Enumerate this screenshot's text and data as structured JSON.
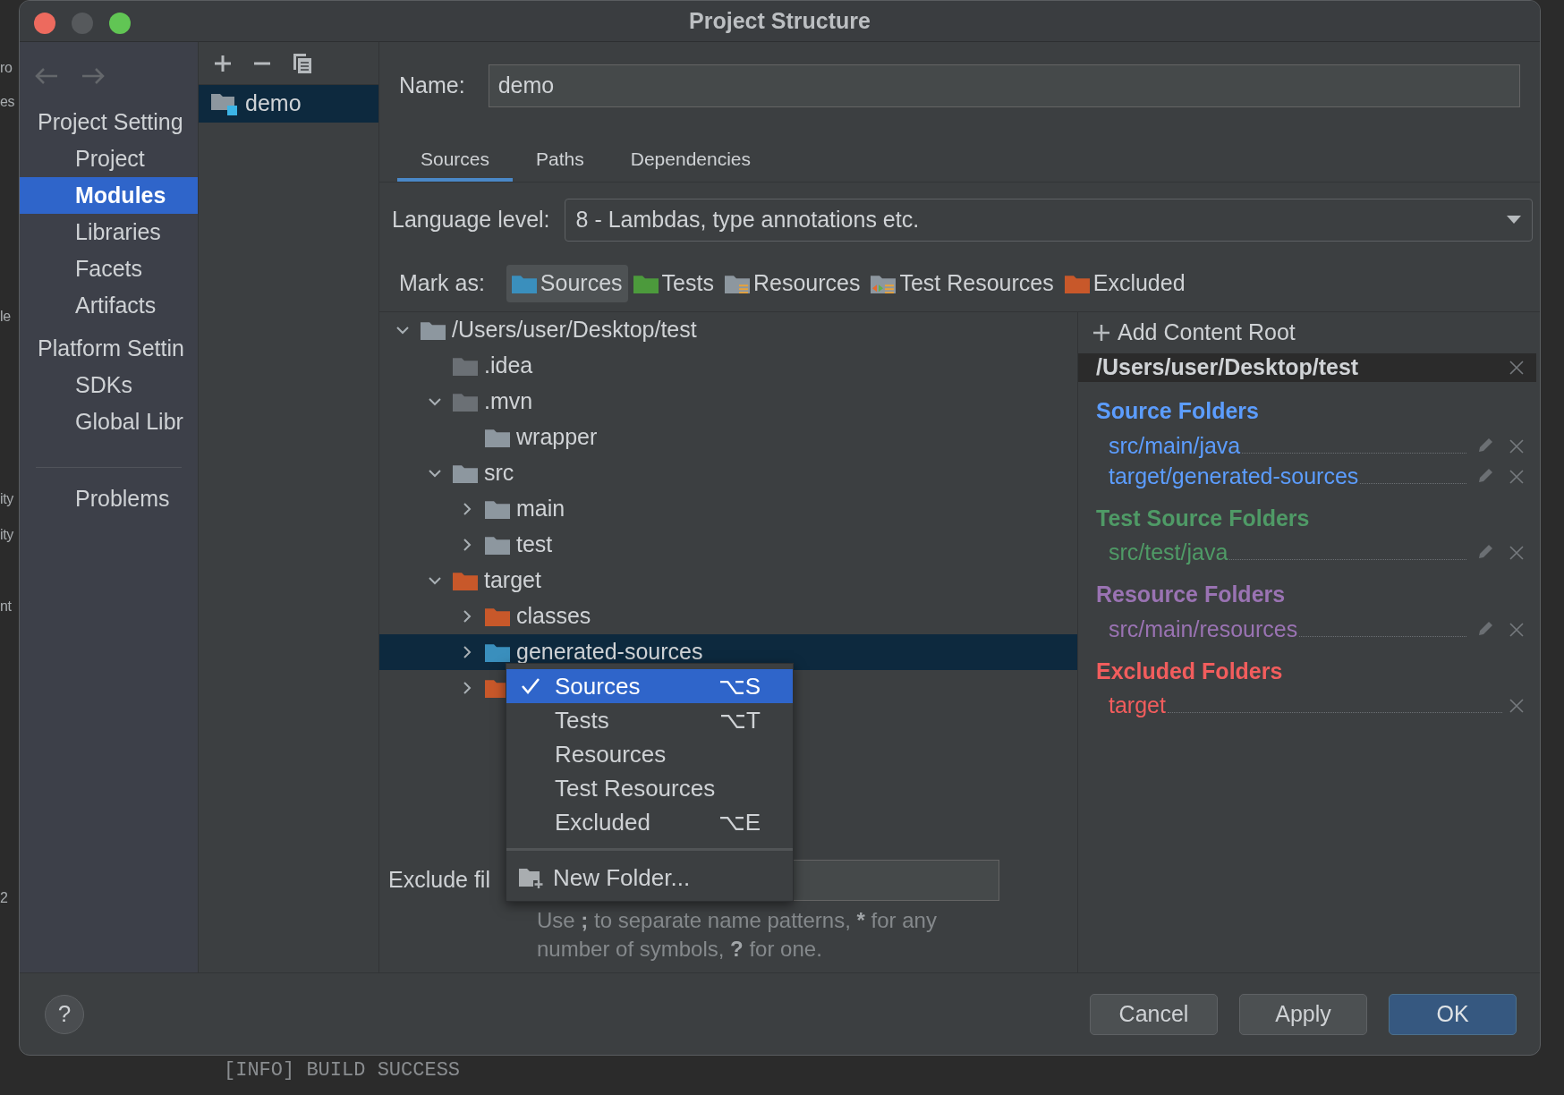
{
  "background": {
    "fragments": [
      "ro",
      "es",
      "le",
      "ity",
      "ity",
      "nt",
      "2"
    ],
    "console_line": "[INFO] BUILD SUCCESS"
  },
  "window": {
    "title": "Project Structure"
  },
  "sidebar": {
    "sections": [
      {
        "heading": "Project Setting",
        "items": [
          {
            "label": "Project",
            "selected": false
          },
          {
            "label": "Modules",
            "selected": true
          },
          {
            "label": "Libraries",
            "selected": false
          },
          {
            "label": "Facets",
            "selected": false
          },
          {
            "label": "Artifacts",
            "selected": false
          }
        ]
      },
      {
        "heading": "Platform Settin",
        "items": [
          {
            "label": "SDKs",
            "selected": false
          },
          {
            "label": "Global Libr",
            "selected": false
          }
        ]
      }
    ],
    "bottom_items": [
      {
        "label": "Problems",
        "selected": false
      }
    ]
  },
  "modules": [
    {
      "name": "demo",
      "selected": true
    }
  ],
  "name_field": {
    "label": "Name:",
    "value": "demo"
  },
  "tabs": [
    {
      "label": "Sources",
      "selected": true
    },
    {
      "label": "Paths",
      "selected": false
    },
    {
      "label": "Dependencies",
      "selected": false
    }
  ],
  "language_level": {
    "label": "Language level:",
    "value": "8 - Lambdas, type annotations etc."
  },
  "mark_as": {
    "label": "Mark as:",
    "buttons": [
      {
        "label": "Sources",
        "kind": "sources",
        "selected": true
      },
      {
        "label": "Tests",
        "kind": "tests",
        "selected": false
      },
      {
        "label": "Resources",
        "kind": "resources",
        "selected": false
      },
      {
        "label": "Test Resources",
        "kind": "test_resources",
        "selected": false
      },
      {
        "label": "Excluded",
        "kind": "excluded",
        "selected": false
      }
    ]
  },
  "tree": [
    {
      "name": "/Users/user/Desktop/test",
      "kind": "plain",
      "expanded": true,
      "selected": false,
      "children": [
        {
          "name": ".idea",
          "kind": "hidden",
          "selected": false
        },
        {
          "name": ".mvn",
          "kind": "hidden",
          "expanded": true,
          "selected": false,
          "children": [
            {
              "name": "wrapper",
              "kind": "plain",
              "selected": false
            }
          ]
        },
        {
          "name": "src",
          "kind": "plain",
          "expanded": true,
          "selected": false,
          "children": [
            {
              "name": "main",
              "kind": "plain",
              "expanded": false,
              "selected": false
            },
            {
              "name": "test",
              "kind": "plain",
              "expanded": false,
              "selected": false
            }
          ]
        },
        {
          "name": "target",
          "kind": "excluded",
          "expanded": true,
          "selected": false,
          "children": [
            {
              "name": "classes",
              "kind": "excluded",
              "expanded": false,
              "selected": false
            },
            {
              "name": "generated-sources",
              "kind": "sources",
              "expanded": false,
              "selected": true
            },
            {
              "kind": "excluded",
              "expanded": false,
              "selected": false
            }
          ]
        }
      ]
    }
  ],
  "exclude_files": {
    "label": "Exclude fil",
    "hint": [
      {
        "text": "Use ",
        "bold": false
      },
      {
        "text": ";",
        "bold": true
      },
      {
        "text": " to separate name patterns, ",
        "bold": false
      },
      {
        "text": "*",
        "bold": true
      },
      {
        "text": " for any number of symbols, ",
        "bold": false
      },
      {
        "text": "?",
        "bold": true
      },
      {
        "text": " for one.",
        "bold": false
      }
    ]
  },
  "content_roots": {
    "add_button": "Add Content Root",
    "root": "/Users/user/Desktop/test",
    "groups": [
      {
        "title": "Source Folders",
        "color": "#5c9dff",
        "items": [
          {
            "path": "src/main/java",
            "editable": true
          },
          {
            "path": "target/generated-sources",
            "editable": true
          }
        ]
      },
      {
        "title": "Test Source Folders",
        "color": "#4f9a66",
        "items": [
          {
            "path": "src/test/java",
            "editable": true
          }
        ]
      },
      {
        "title": "Resource Folders",
        "color": "#9a73b3",
        "items": [
          {
            "path": "src/main/resources",
            "editable": true
          }
        ]
      },
      {
        "title": "Excluded Folders",
        "color": "#f25d5d",
        "items": [
          {
            "path": "target",
            "editable": false
          }
        ]
      }
    ]
  },
  "context_menu": {
    "items": [
      {
        "label": "Sources",
        "shortcut": "⌥S",
        "checked": true,
        "selected": true
      },
      {
        "label": "Tests",
        "shortcut": "⌥T",
        "checked": false,
        "selected": false
      },
      {
        "label": "Resources",
        "checked": false,
        "selected": false
      },
      {
        "label": "Test Resources",
        "checked": false,
        "selected": false
      },
      {
        "label": "Excluded",
        "shortcut": "⌥E",
        "checked": false,
        "selected": false
      }
    ],
    "new_folder": "New Folder..."
  },
  "footer": {
    "help": "?",
    "buttons": [
      {
        "label": "Cancel",
        "kind": "normal"
      },
      {
        "label": "Apply",
        "kind": "normal"
      },
      {
        "label": "OK",
        "kind": "default"
      }
    ]
  }
}
